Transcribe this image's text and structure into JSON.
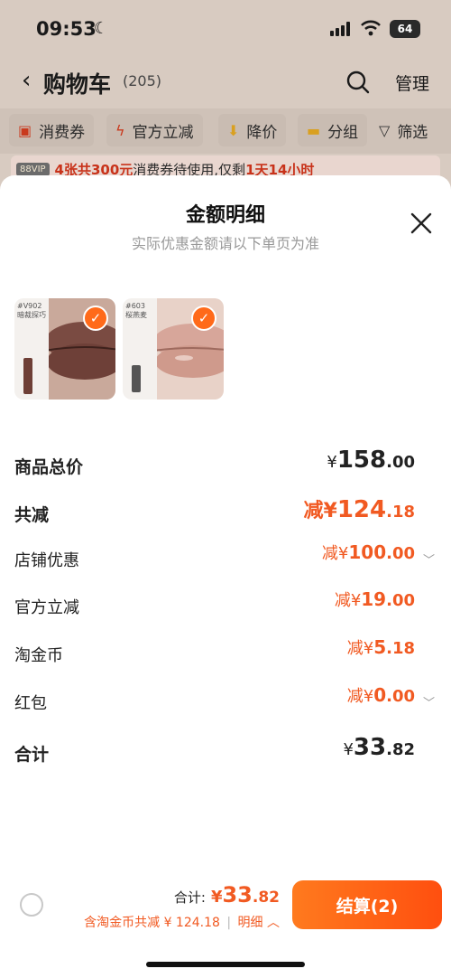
{
  "status_bar": {
    "time": "09:53",
    "battery": "64"
  },
  "nav": {
    "title": "购物车",
    "count": "(205)",
    "manage_label": "管理"
  },
  "filters": {
    "coupon": "消费券",
    "official": "官方立减",
    "price_drop": "降价",
    "group": "分组",
    "filter": "筛选"
  },
  "promo": {
    "tag": "88VIP",
    "coupons": "4张共300元",
    "middle": "消费券待使用,仅剩",
    "remaining": "1天14小时"
  },
  "sheet": {
    "title": "金额明细",
    "subtitle": "实际优惠金额请以下单页为准",
    "products": [
      {
        "code": "#V902",
        "name": "暗裁探巧",
        "lip_color": "#7a4b42"
      },
      {
        "code": "#603",
        "name": "桜燕麦",
        "lip_color": "#d7a69a"
      }
    ],
    "rows": {
      "total_price": {
        "label": "商品总价",
        "yen": "¥",
        "int": "158",
        "dec": ".00"
      },
      "total_discount": {
        "label": "共减",
        "prefix": "减",
        "yen": "¥",
        "int": "124",
        "dec": ".18"
      },
      "store_discount": {
        "label": "店铺优惠",
        "prefix": "减",
        "yen": "¥",
        "int": "100",
        "dec": ".00"
      },
      "official_discount": {
        "label": "官方立减",
        "prefix": "减",
        "yen": "¥",
        "int": "19",
        "dec": ".00"
      },
      "taobao_coins": {
        "label": "淘金币",
        "prefix": "减",
        "yen": "¥",
        "int": "5",
        "dec": ".18"
      },
      "red_packet": {
        "label": "红包",
        "prefix": "减",
        "yen": "¥",
        "int": "0",
        "dec": ".00"
      },
      "subtotal": {
        "label": "合计",
        "yen": "¥",
        "int": "33",
        "dec": ".82"
      }
    }
  },
  "bottom_bar": {
    "total_label": "合计:",
    "total_yen": "¥",
    "total_int": "33",
    "total_dec": ".82",
    "savings_text": "含淘金币共减 ¥ 124.18",
    "detail_label": "明细",
    "checkout_label": "结算(2)"
  },
  "colors": {
    "accent": "#ff5a14",
    "price_orange": "#f15a22",
    "check": "#ff6a1a"
  }
}
